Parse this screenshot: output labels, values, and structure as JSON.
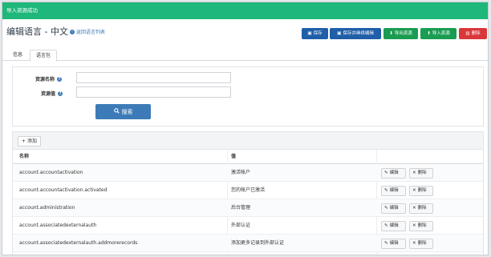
{
  "notification": {
    "text": "导入资源成功"
  },
  "header": {
    "title": "编辑语言 - 中文",
    "back_link": "返回语言列表",
    "buttons": {
      "save": "保存",
      "save_continue": "保存并继续编辑",
      "export": "导出资源",
      "import": "导入资源",
      "delete": "删除"
    }
  },
  "tabs": [
    {
      "label": "信息"
    },
    {
      "label": "语言包"
    }
  ],
  "search": {
    "name_label": "资源名称",
    "value_label": "资源值",
    "name_value": "",
    "value_value": "",
    "button": "搜索"
  },
  "grid": {
    "add_button": "添加",
    "columns": {
      "name": "名称",
      "value": "值"
    },
    "edit_label": "编辑",
    "delete_label": "删除",
    "rows": [
      {
        "name": "account.accountactivation",
        "value": "激活帐户"
      },
      {
        "name": "account.accountactivation.activated",
        "value": "您的帐户已激活"
      },
      {
        "name": "account.administration",
        "value": "后台管理"
      },
      {
        "name": "account.associatedexternalauth",
        "value": "外部认证"
      },
      {
        "name": "account.associatedexternalauth.addmorerecords",
        "value": "添加更多记录到外部认证"
      }
    ]
  },
  "colors": {
    "success": "#1fb77a",
    "primary": "#1f5ea8",
    "green": "#1a9c52",
    "danger": "#d9383a",
    "info": "#3c7bb8"
  }
}
